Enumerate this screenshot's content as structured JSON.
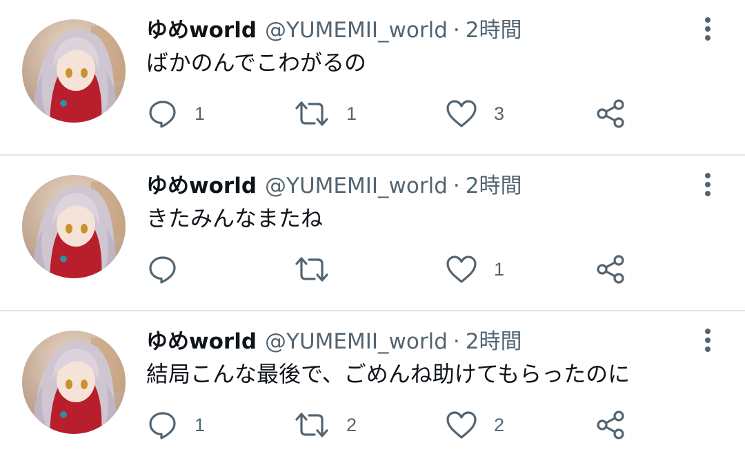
{
  "colors": {
    "primary_text": "#0f1419",
    "secondary_text": "#536471",
    "icon": "#536471",
    "divider": "#e1e6ea",
    "background": "#ffffff"
  },
  "icons": {
    "reply": "speech-bubble",
    "retweet": "retweet-arrows",
    "like": "heart",
    "share": "share-nodes",
    "more": "vertical-ellipsis"
  },
  "tweets": [
    {
      "display_name": "ゆめworld",
      "handle": "@YUMEMII_world",
      "separator": "·",
      "time": "2時間",
      "text": "ばかのんでこわがるの",
      "replies": "1",
      "retweets": "1",
      "likes": "3"
    },
    {
      "display_name": "ゆめworld",
      "handle": "@YUMEMII_world",
      "separator": "·",
      "time": "2時間",
      "text": "きたみんなまたね",
      "replies": "",
      "retweets": "",
      "likes": "1"
    },
    {
      "display_name": "ゆめworld",
      "handle": "@YUMEMII_world",
      "separator": "·",
      "time": "2時間",
      "text": "結局こんな最後で、ごめんね助けてもらったのに",
      "replies": "1",
      "retweets": "2",
      "likes": "2"
    }
  ]
}
